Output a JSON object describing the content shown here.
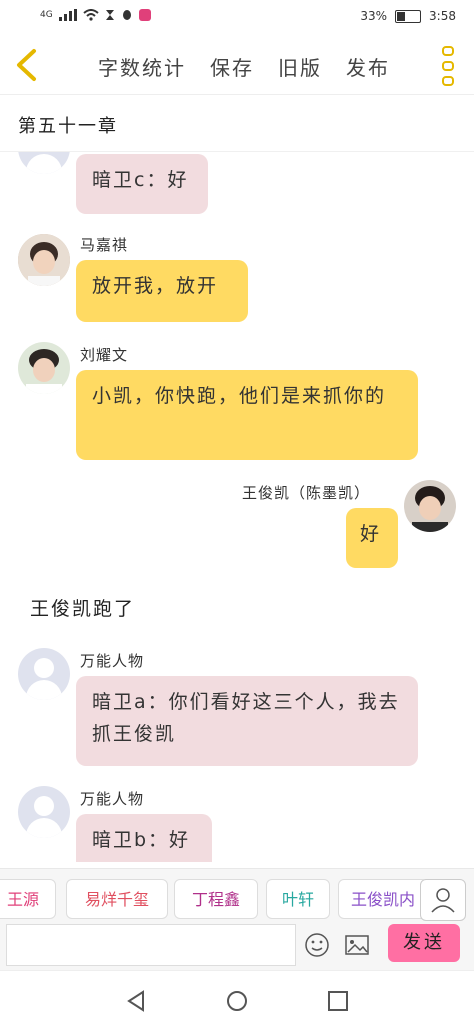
{
  "status_bar": {
    "network": "4G",
    "battery": "33%",
    "time": "3:58"
  },
  "toolbar": {
    "items": [
      {
        "label": "字数统计"
      },
      {
        "label": "保存"
      },
      {
        "label": "旧版"
      },
      {
        "label": "发布"
      }
    ]
  },
  "chapter": {
    "title": "第五十一章"
  },
  "messages": [
    {
      "type": "left",
      "speaker": "",
      "text": "暗卫c：好",
      "bubble": "pink",
      "avatar": "placeholder-avatar"
    },
    {
      "type": "left",
      "speaker": "马嘉祺",
      "text": "放开我，放开",
      "bubble": "yellow",
      "avatar": "photo-avatar"
    },
    {
      "type": "left",
      "speaker": "刘耀文",
      "text": "小凯，你快跑，他们是来抓你的",
      "bubble": "yellow",
      "avatar": "photo-avatar"
    },
    {
      "type": "right",
      "speaker": "王俊凯（陈墨凯）",
      "text": "好",
      "bubble": "yellow",
      "avatar": "photo-avatar"
    },
    {
      "type": "narration",
      "text": "王俊凯跑了"
    },
    {
      "type": "left",
      "speaker": "万能人物",
      "text": "暗卫a：你们看好这三个人，我去抓王俊凯",
      "bubble": "pink",
      "avatar": "placeholder-avatar"
    },
    {
      "type": "left",
      "speaker": "万能人物",
      "text": "暗卫b：好",
      "bubble": "pink",
      "avatar": "placeholder-avatar"
    }
  ],
  "characters": [
    {
      "label": "王源",
      "color": "#e0407a"
    },
    {
      "label": "易烊千玺",
      "color": "#e05060"
    },
    {
      "label": "丁程鑫",
      "color": "#b0308a"
    },
    {
      "label": "叶轩",
      "color": "#28a8a0"
    },
    {
      "label": "王俊凯内",
      "color": "#8a50c8"
    }
  ],
  "input": {
    "placeholder": "",
    "send_label": "发送"
  },
  "colors": {
    "accent": "#ffda62",
    "pink_bubble": "#f2dcdf",
    "send": "#ff6fa3"
  }
}
